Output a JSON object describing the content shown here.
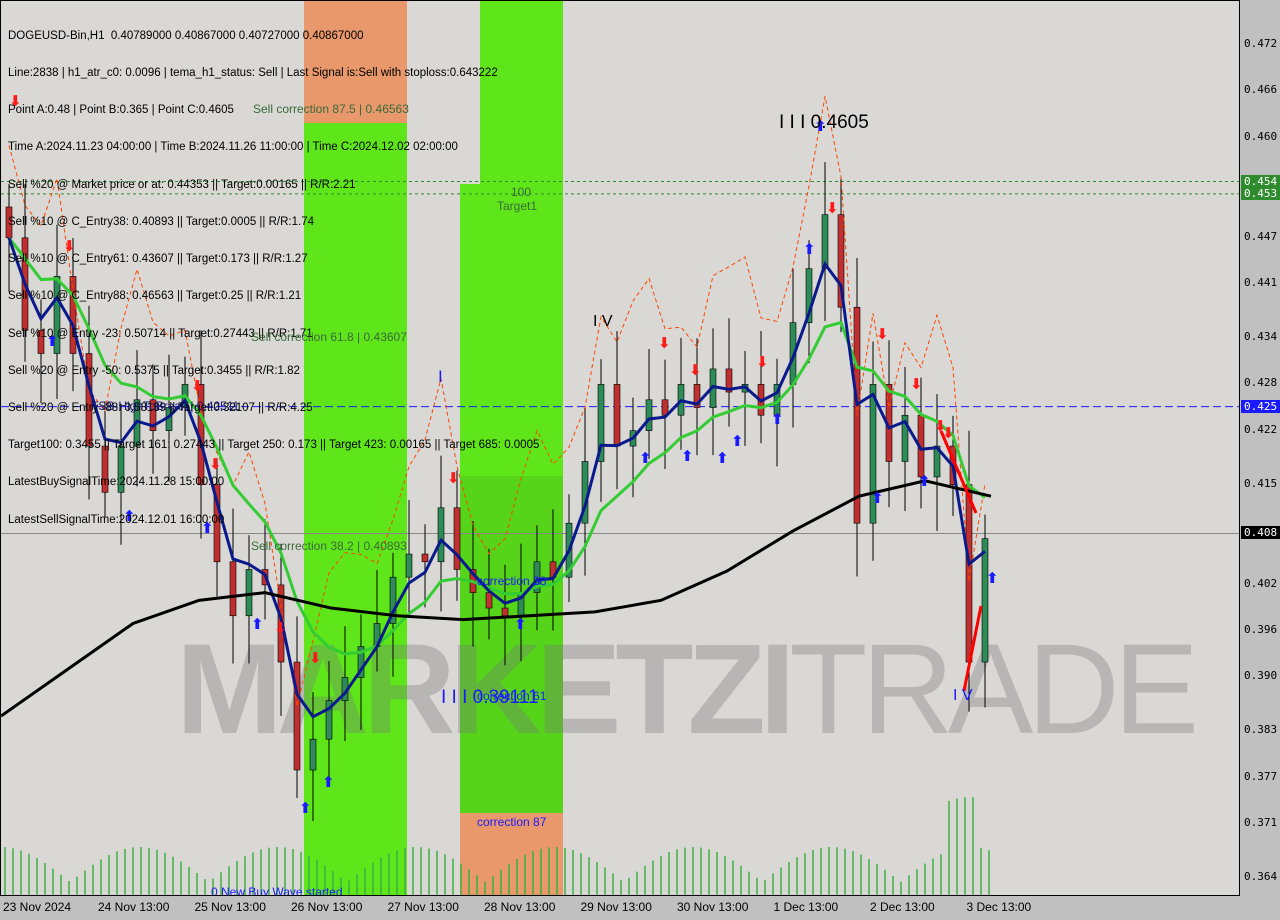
{
  "header": {
    "lines": [
      "DOGEUSD-Bin,H1  0.40789000 0.40867000 0.40727000 0.40867000",
      "Line:2838 | h1_atr_c0: 0.0096 | tema_h1_status: Sell | Last Signal is:Sell with stoploss:0.643222",
      "Point A:0.48 | Point B:0.365 | Point C:0.4605",
      "Time A:2024.11.23 04:00:00 | Time B:2024.11.26 11:00:00 | Time C:2024.12.02 02:00:00",
      "Sell %20 @ Market price or at: 0.44353 || Target:0.00165 || R/R:2.21",
      "Sell %10 @ C_Entry38: 0.40893 || Target:0.0005 || R/R:1.74",
      "Sell %10 @ C_Entry61: 0.43607 || Target:0.173 || R/R:1.27",
      "Sell %10 @ C_Entry88: 0.46563 || Target:0.25 || R/R:1.21",
      "Sell %10 @ Entry -23: 0.50714 || Target:0.27443 || R/R:1.71",
      "Sell %20 @ Entry -50: 0.5375 || Target:0.3455 || R/R:1.82",
      "Sell %20 @ Entry -88: 0.58189 || Target:0.32107 || R/R:4.25",
      "Target100: 0.3455 || Target 161: 0.27443 || Target 250: 0.173 || Target 423: 0.00165 || Target 685: 0.0005",
      "LatestBuySignalTime:2024.11.28 15:00:00",
      "LatestSellSignalTime:2024.12.01 16:00:00"
    ]
  },
  "annotations": {
    "sell_corr_875": "Sell correction 87.5 | 0.46563",
    "sell_corr_618": "Sell correction 61.8 | 0.43607",
    "fsb": "FSB-HighToBreak | 0.42511",
    "sell_corr_382": "Sell correction 38.2 | 0.40893",
    "target_100": "100",
    "target1": "Target1",
    "correction_38": "correction 38",
    "correction_61": "correction 61",
    "correction_87": "correction 87",
    "wave_iii_high": "I I I 0.4605",
    "wave_iii_low": "I I I 0.39111",
    "wave_iv_1": "I V",
    "wave_iv_2": "I V",
    "wave_i": "I",
    "new_buy_wave": "0 New Buy Wave started",
    "watermark": "MARKETZITRADE"
  },
  "colors": {
    "bg": "#d9d8d5",
    "green_zone": "#5fe61a",
    "orange_zone": "#e8986a",
    "bull": "#2e8b57",
    "bear": "#c03030",
    "ma_fast": "#0a1a8c",
    "ma_mid": "#33cc33",
    "ma_slow": "#000000",
    "fsb_line": "#1a1aff",
    "target_line": "#2e8b2e"
  },
  "chart_data": {
    "type": "candlestick",
    "symbol": "DOGEUSD-Bin",
    "timeframe": "H1",
    "ylim": [
      0.362,
      0.477
    ],
    "y_ticks": [
      "0.472",
      "0.466",
      "0.460",
      "0.447",
      "0.441",
      "0.434",
      "0.428",
      "0.422",
      "0.415",
      "0.402",
      "0.396",
      "0.390",
      "0.383",
      "0.377",
      "0.371",
      "0.364"
    ],
    "y_tags": [
      {
        "label": "0.454",
        "value": 0.4543,
        "color": "#2e8b2e"
      },
      {
        "label": "0.453",
        "value": 0.4527,
        "color": "#2e8b2e"
      },
      {
        "label": "0.425",
        "value": 0.4251,
        "color": "#1a1aff"
      },
      {
        "label": "0.408",
        "value": 0.4087,
        "color": "#000000"
      }
    ],
    "x_ticks": [
      "23 Nov 2024",
      "24 Nov 13:00",
      "25 Nov 13:00",
      "26 Nov 13:00",
      "27 Nov 13:00",
      "28 Nov 13:00",
      "29 Nov 13:00",
      "30 Nov 13:00",
      "1 Dec 13:00",
      "2 Dec 13:00",
      "3 Dec 13:00"
    ],
    "closes": [
      0.447,
      0.435,
      0.432,
      0.442,
      0.432,
      0.42,
      0.414,
      0.42,
      0.426,
      0.422,
      0.425,
      0.428,
      0.415,
      0.405,
      0.398,
      0.404,
      0.402,
      0.392,
      0.378,
      0.382,
      0.387,
      0.39,
      0.394,
      0.397,
      0.403,
      0.406,
      0.405,
      0.412,
      0.404,
      0.401,
      0.399,
      0.398,
      0.401,
      0.405,
      0.403,
      0.41,
      0.418,
      0.428,
      0.42,
      0.422,
      0.426,
      0.424,
      0.428,
      0.425,
      0.43,
      0.427,
      0.428,
      0.424,
      0.428,
      0.436,
      0.443,
      0.45,
      0.438,
      0.41,
      0.428,
      0.418,
      0.424,
      0.416,
      0.42,
      0.415,
      0.392,
      0.408
    ],
    "ma_slow": [
      0.385,
      0.391,
      0.397,
      0.4,
      0.401,
      0.399,
      0.398,
      0.3975,
      0.398,
      0.3985,
      0.4,
      0.4038,
      0.409,
      0.4135,
      0.4155,
      0.4135
    ],
    "levels": {
      "target_upper": 0.4543,
      "target_lower": 0.4527,
      "fsb_high_to_break": 0.42511,
      "current": 0.40867
    }
  }
}
